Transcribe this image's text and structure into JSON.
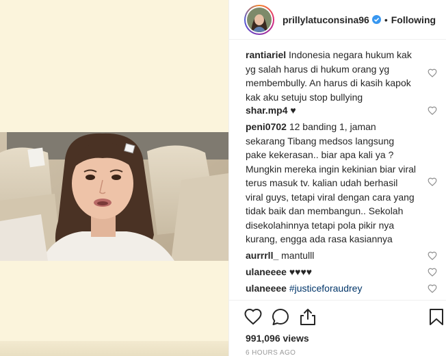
{
  "post": {
    "username": "prillylatuconsina96",
    "separator": "•",
    "follow_label": "Following",
    "views": "991,096 views",
    "timestamp": "6 HOURS AGO"
  },
  "comments": [
    {
      "user": "rantiariel",
      "text": "Indonesia negara hukum kak yg salah harus di hukum orang yg membembully. An harus di kasih kapok kak aku setuju stop bullying"
    },
    {
      "user": "shar.mp4",
      "text": "♥"
    },
    {
      "user": "peni0702",
      "text": "12 banding 1, jaman sekarang Tibang medsos langsung pake kekerasan.. biar apa kali ya ? Mungkin mereka ingin kekinian biar viral terus masuk tv. kalian udah berhasil viral guys, tetapi viral dengan cara yang tidak baik dan membangun.. Sekolah disekolahinnya tetapi pola pikir nya kurang, engga ada rasa kasiannya"
    },
    {
      "user": "aurrrll_",
      "text": "mantulll"
    },
    {
      "user": "ulaneeee",
      "text": "♥♥♥♥"
    },
    {
      "user": "ulaneeee",
      "text": "#justiceforaudrey"
    }
  ],
  "icons": {
    "like": "heart-icon",
    "comment": "comment-icon",
    "share": "share-icon",
    "save": "bookmark-icon",
    "verified": "verified-badge-icon"
  },
  "colors": {
    "text": "#262626",
    "link": "#003569",
    "muted": "#999999",
    "verified": "#3897f0",
    "media_bg": "#fbf4dc"
  }
}
